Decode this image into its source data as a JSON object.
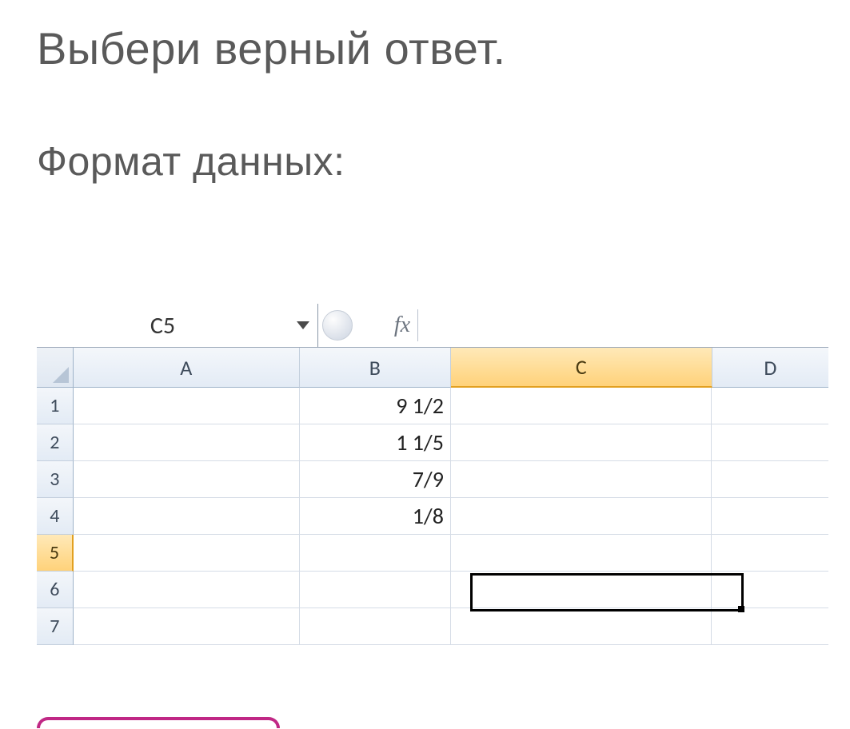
{
  "question": {
    "title": "Выбери верный ответ.",
    "subtitle": "Формат данных:"
  },
  "excel": {
    "namebox": "C5",
    "fx_label": "fx",
    "columns": [
      "A",
      "B",
      "C",
      "D"
    ],
    "active_column": "C",
    "rows": [
      "1",
      "2",
      "3",
      "4",
      "5",
      "6",
      "7"
    ],
    "active_row": "5",
    "data": {
      "B1": "9 1/2",
      "B2": "1 1/5",
      "B3": "7/9",
      "B4": "1/8"
    },
    "selection": {
      "cell": "C5"
    }
  },
  "colors": {
    "accent": "#c02885",
    "header_active": "#ffd27a"
  }
}
